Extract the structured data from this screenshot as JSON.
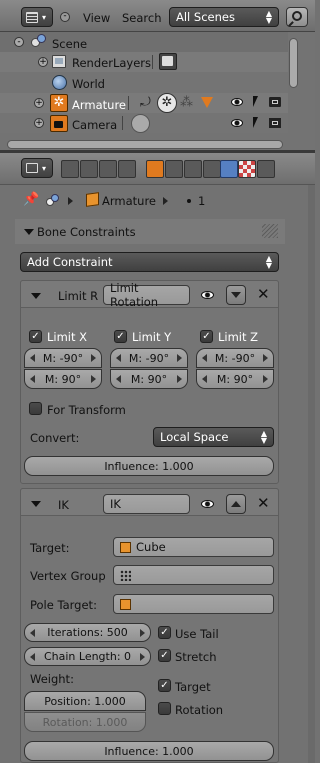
{
  "outliner": {
    "menu_view": "View",
    "menu_search": "Search",
    "scene_selector": "All Scenes",
    "tree": [
      {
        "label": "Scene",
        "icon": "scene-icon"
      },
      {
        "label": "RenderLayers",
        "icon": "renderlayers-icon"
      },
      {
        "label": "World",
        "icon": "world-icon"
      },
      {
        "label": "Armature",
        "icon": "armature-icon"
      },
      {
        "label": "Camera",
        "icon": "camera-icon"
      }
    ]
  },
  "properties": {
    "breadcrumb": {
      "object": "Armature",
      "bone": "1"
    },
    "section_title": "Bone Constraints",
    "add_constraint": "Add Constraint",
    "limit": {
      "type_short": "Limit R",
      "name": "Limit Rotation",
      "axes": [
        {
          "label": "Limit X",
          "min": "M: -90°",
          "max": "M: 90°"
        },
        {
          "label": "Limit Y",
          "min": "M: -90°",
          "max": "M: 90°"
        },
        {
          "label": "Limit Z",
          "min": "M: -90°",
          "max": "M: 90°"
        }
      ],
      "for_transform": "For Transform",
      "convert_label": "Convert:",
      "convert_value": "Local Space",
      "influence": "Influence: 1.000"
    },
    "ik": {
      "type_short": "IK",
      "name": "IK",
      "target_label": "Target:",
      "target_value": "Cube",
      "vertex_group_label": "Vertex Group",
      "pole_target_label": "Pole Target:",
      "iterations": "Iterations: 500",
      "chain_length": "Chain Length: 0",
      "use_tail": "Use Tail",
      "stretch": "Stretch",
      "weight_label": "Weight:",
      "position": "Position: 1.000",
      "rotation_weight": "Rotation: 1.000",
      "target_check": "Target",
      "rotation_check": "Rotation",
      "influence": "Influence: 1.000"
    }
  },
  "colors": {
    "accent": "#5680c2",
    "panel_bg": "#727272",
    "outliner_bg": "#737373"
  }
}
